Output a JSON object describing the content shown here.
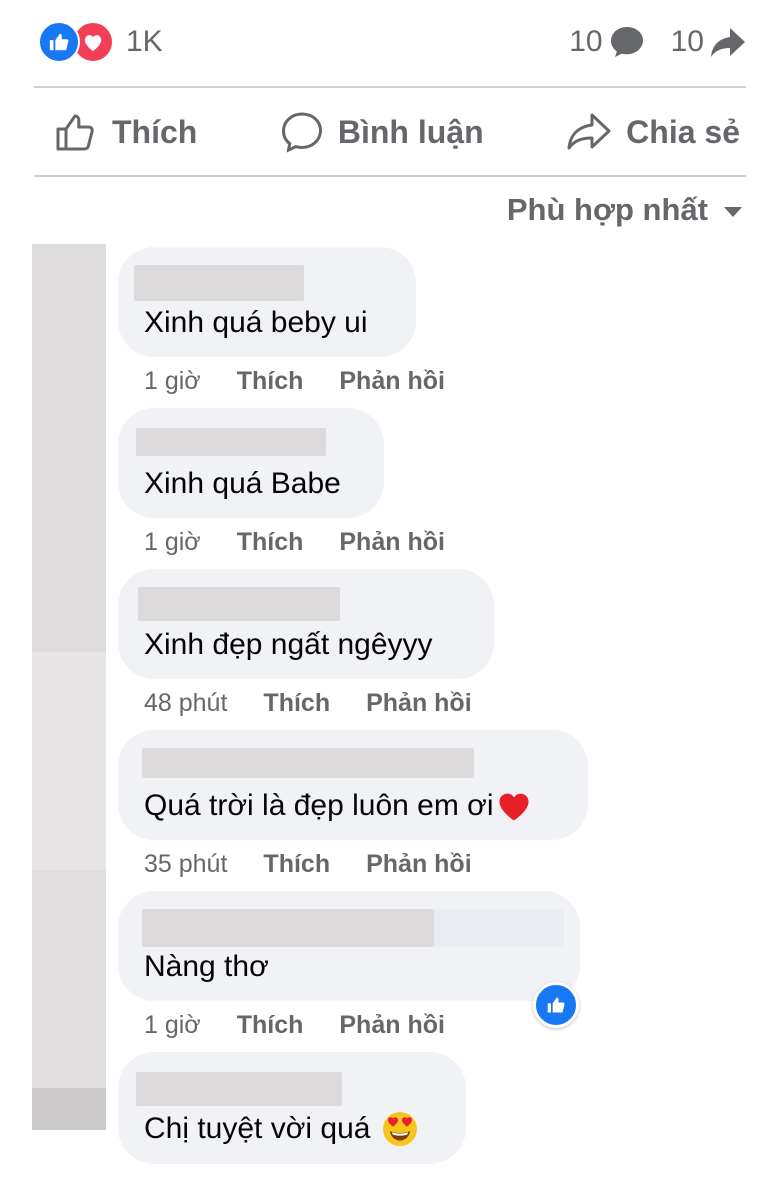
{
  "stats": {
    "reaction_count": "1K",
    "comment_count": "10",
    "share_count": "10"
  },
  "actions": {
    "like_label": "Thích",
    "comment_label": "Bình luận",
    "share_label": "Chia sẻ"
  },
  "sort": {
    "label": "Phù hợp nhất"
  },
  "comments": [
    {
      "text": "Xinh quá beby ui",
      "time": "1 giờ",
      "like_label": "Thích",
      "reply_label": "Phản hồi"
    },
    {
      "text": "Xinh quá Babe",
      "time": "1 giờ",
      "like_label": "Thích",
      "reply_label": "Phản hồi"
    },
    {
      "text": "Xinh đẹp ngất ngêyyy",
      "time": "48 phút",
      "like_label": "Thích",
      "reply_label": "Phản hồi"
    },
    {
      "text": "Quá trời là đẹp luôn em ơi",
      "time": "35 phút",
      "like_label": "Thích",
      "reply_label": "Phản hồi",
      "emoji": "heart-icon"
    },
    {
      "text": "Nàng thơ",
      "time": "1 giờ",
      "like_label": "Thích",
      "reply_label": "Phản hồi",
      "reaction": "like-icon"
    },
    {
      "text": "Chị tuyệt vời quá",
      "emoji": "heart-eyes-emoji"
    }
  ],
  "colors": {
    "brand_blue": "#1877f2",
    "love_red": "#f33e58",
    "heart_red": "#e8202a",
    "bubble_bg": "#f0f2f5",
    "secondary_text": "#65676b"
  }
}
